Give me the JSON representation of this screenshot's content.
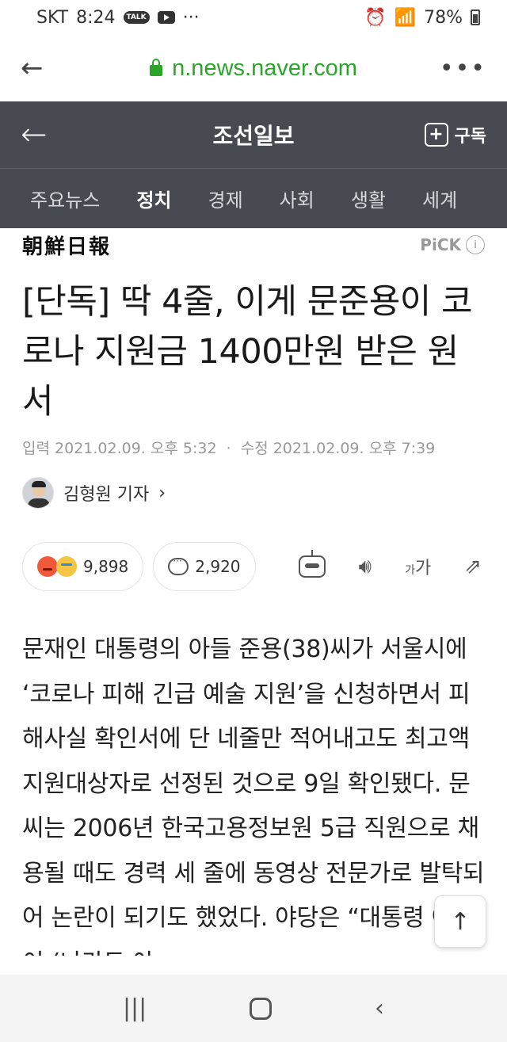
{
  "status": {
    "carrier": "SKT",
    "time": "8:24",
    "talk": "TALK",
    "dots": "···",
    "battery": "78%"
  },
  "browser": {
    "url": "n.news.naver.com",
    "back": "←",
    "menu": "•••"
  },
  "header": {
    "back": "←",
    "title": "조선일보",
    "subscribe_label": "구독",
    "plus": "+"
  },
  "tabs": [
    {
      "label": "주요뉴스",
      "active": false
    },
    {
      "label": "정치",
      "active": true
    },
    {
      "label": "경제",
      "active": false
    },
    {
      "label": "사회",
      "active": false
    },
    {
      "label": "생활",
      "active": false
    },
    {
      "label": "세계",
      "active": false
    }
  ],
  "press": {
    "logo": "朝鮮日報",
    "pick": "PiCK",
    "info": "i"
  },
  "article": {
    "headline": "[단독] 딱 4줄, 이게 문준용이 코로나 지원금 1400만원 받은 원서",
    "input_label": "입력",
    "input_date": "2021.02.09. 오후 5:32",
    "edit_label": "수정",
    "edit_date": "2021.02.09. 오후 7:39",
    "dot": "·",
    "author": "김형원 기자",
    "author_chevron": "›",
    "body": "문재인 대통령의 아들 준용(38)씨가 서울시에 ‘코로나 피해 긴급 예술 지원’을 신청하면서 피해사실 확인서에 단 네줄만 적어내고도 최고액 지원대상자로 선정된 것으로 9일 확인됐다. 문씨는 2006년 한국고용정보원 5급 직원으로 채용될 때도 경력 세 줄에 동영상 전문가로 발탁되어 논란이 되기도 했었다. 야당은 “대통령 아들이 (나라도 아"
  },
  "actions": {
    "reactions_count": "9,898",
    "comments_count": "2,920",
    "font_small": "가",
    "font_large": "가",
    "speaker": "🔊︎",
    "share": "⇗"
  },
  "scroll_top": "↑",
  "navbar": {
    "recent": "|||",
    "back": "‹"
  }
}
